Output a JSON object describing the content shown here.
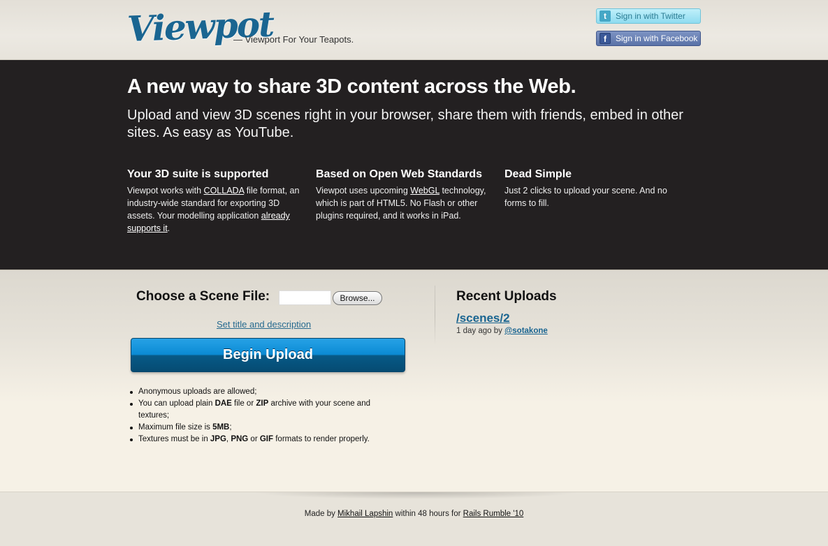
{
  "header": {
    "logo": "Viewpot",
    "tagline": "— Viewport For Your Teapots.",
    "twitter_icon": "t",
    "twitter_label": "Sign in with Twitter",
    "facebook_icon": "f",
    "facebook_label": "Sign in with Facebook"
  },
  "hero": {
    "title": "A new way to share 3D content across the Web.",
    "lead": "Upload and view 3D scenes right in your browser, share them with friends, embed in other sites. As easy as YouTube.",
    "features": [
      {
        "title": "Your 3D suite is supported",
        "text_1": "Viewpot works with ",
        "link_1": "COLLADA",
        "text_2": " file format, an industry-wide standard for exporting 3D assets. Your modelling application ",
        "link_2": "already supports it",
        "text_3": "."
      },
      {
        "title": "Based on Open Web Standards",
        "text_1": "Viewpot uses upcoming ",
        "link_1": "WebGL",
        "text_2": " technology, which is part of HTML5. No Flash or other plugins required, and it works in iPad."
      },
      {
        "title": "Dead Simple",
        "text_1": "Just 2 clicks to upload your scene. And no forms to fill."
      }
    ]
  },
  "upload": {
    "choose_label": "Choose a Scene File:",
    "file_value": "",
    "browse_label": "Browse...",
    "set_title_link": "Set title and description",
    "button_label": "Begin Upload",
    "rules": [
      {
        "t1": "Anonymous uploads are allowed;"
      },
      {
        "t1": "You can upload plain ",
        "b1": "DAE",
        "t2": " file or ",
        "b2": "ZIP",
        "t3": " archive with your scene and textures;"
      },
      {
        "t1": "Maximum file size is ",
        "b1": "5MB",
        "t2": ";"
      },
      {
        "t1": "Textures must be in ",
        "b1": "JPG",
        "t2": ", ",
        "b2": "PNG",
        "t3": " or ",
        "b3": "GIF",
        "t4": " formats to render properly."
      }
    ]
  },
  "recent": {
    "title": "Recent Uploads",
    "items": [
      {
        "link": "/scenes/2",
        "meta": "1 day ago by ",
        "user": "@sotakone"
      }
    ]
  },
  "footer": {
    "t1": "Made by ",
    "author": "Mikhail Lapshin",
    "t2": " within 48 hours for ",
    "event": "Rails Rumble '10"
  }
}
